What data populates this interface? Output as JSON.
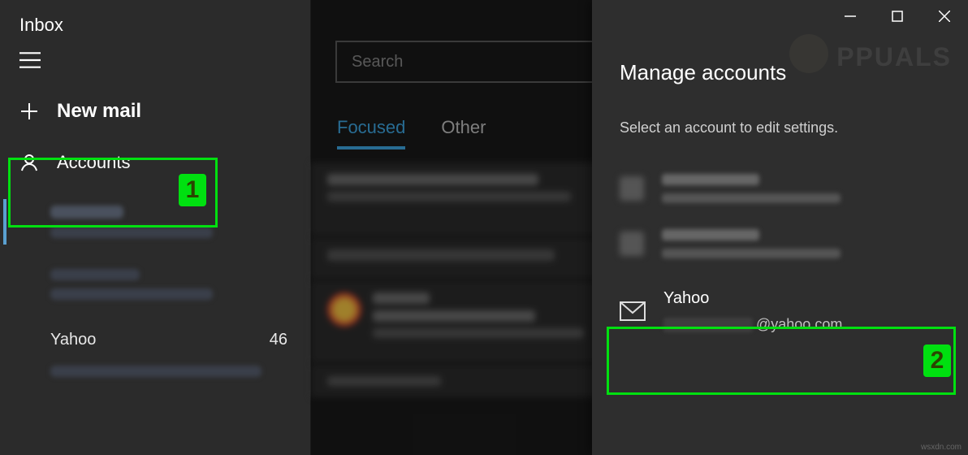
{
  "sidebar": {
    "title": "Inbox",
    "new_mail_label": "New mail",
    "accounts_label": "Accounts",
    "yahoo_label": "Yahoo",
    "yahoo_count": "46"
  },
  "search": {
    "placeholder": "Search"
  },
  "tabs": {
    "focused": "Focused",
    "other": "Other"
  },
  "panel": {
    "title": "Manage accounts",
    "subtitle": "Select an account to edit settings.",
    "yahoo_name": "Yahoo",
    "yahoo_domain": "@yahoo.com"
  },
  "annotations": {
    "badge1": "1",
    "badge2": "2"
  },
  "watermark": "PPUALS",
  "credit": "wsxdn.com",
  "colors": {
    "highlight": "#00e010",
    "accent": "#3ea6e2"
  }
}
